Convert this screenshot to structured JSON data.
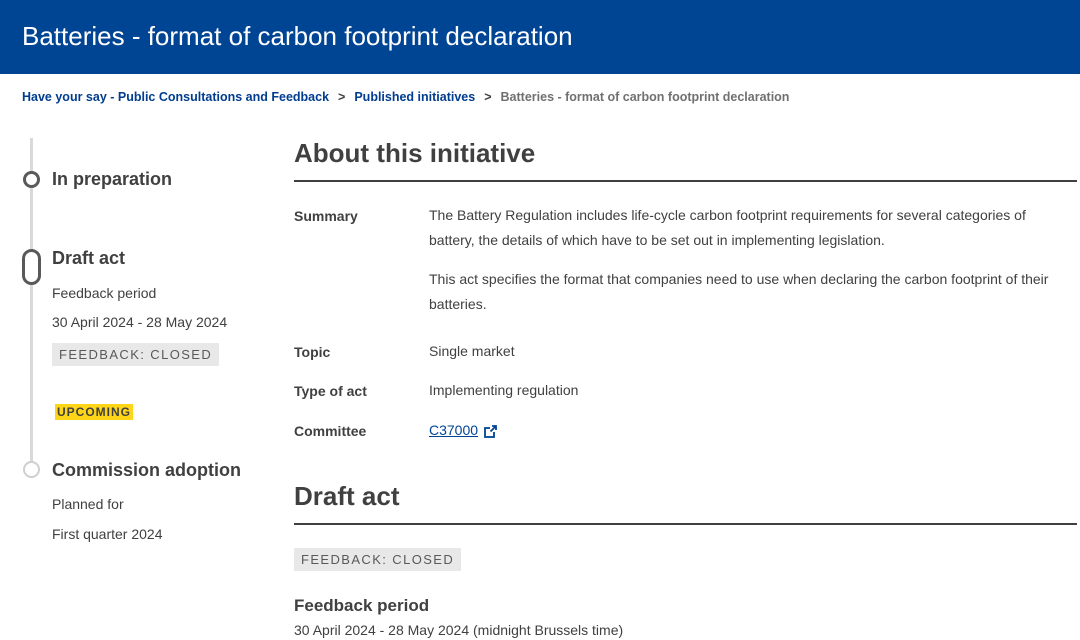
{
  "header": {
    "title": "Batteries - format of carbon footprint declaration"
  },
  "breadcrumb": {
    "items": [
      "Have your say - Public Consultations and Feedback",
      "Published initiatives"
    ],
    "current": "Batteries - format of carbon footprint declaration",
    "separator": ">"
  },
  "timeline": {
    "stage1": {
      "title": "In preparation",
      "state": "completed"
    },
    "stage2": {
      "title": "Draft act",
      "period_label": "Feedback period",
      "period": "30 April 2024 - 28 May 2024",
      "badge": "FEEDBACK: CLOSED",
      "state": "current"
    },
    "upcoming_badge": "UPCOMING",
    "stage3": {
      "title": "Commission adoption",
      "planned_label": "Planned for",
      "planned": "First quarter 2024",
      "state": "future"
    }
  },
  "about": {
    "heading": "About this initiative",
    "summary_label": "Summary",
    "summary_p1": "The Battery Regulation includes life-cycle carbon footprint requirements for several categories of battery, the details of which have to be set out in implementing legislation.",
    "summary_p2": "This act specifies the format that companies need to use when declaring the carbon footprint of their batteries.",
    "topic_label": "Topic",
    "topic": "Single market",
    "type_label": "Type of act",
    "type": "Implementing regulation",
    "committee_label": "Committee",
    "committee": "C37000"
  },
  "draft_act": {
    "heading": "Draft act",
    "badge": "FEEDBACK: CLOSED",
    "feedback_title": "Feedback period",
    "feedback_text": "30 April 2024 - 28 May 2024  (midnight Brussels time)"
  },
  "icons": {
    "external_link": "external-link-icon"
  },
  "colors": {
    "header_bg": "#004494",
    "link": "#004494",
    "upcoming": "#ffd617",
    "badge_bg": "#e8e8e8"
  }
}
